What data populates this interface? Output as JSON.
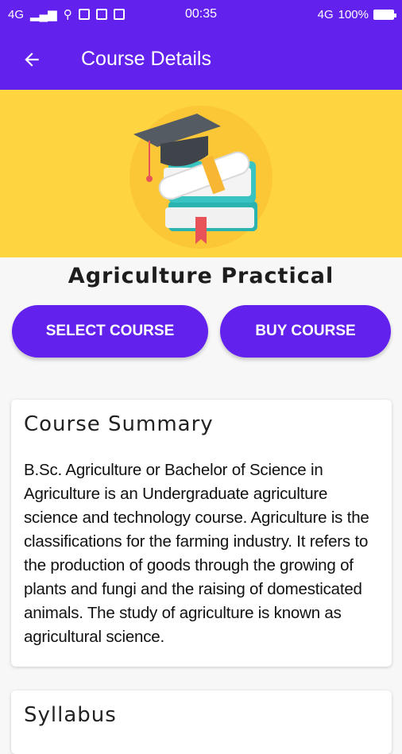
{
  "status_bar": {
    "network": "4G",
    "time": "00:35",
    "network_right": "4G",
    "battery": "100%"
  },
  "app_bar": {
    "title": "Course Details"
  },
  "course": {
    "name": "Agriculture Practical"
  },
  "actions": {
    "select_label": "SELECT COURSE",
    "buy_label": "BUY COURSE"
  },
  "summary": {
    "heading": "Course Summary",
    "body": "B.Sc. Agriculture or Bachelor of Science in Agriculture is an Undergraduate agriculture science and technology course. Agriculture is the classifications for the farming industry. It refers to the production of goods through the growing of plants and fungi and the raising of domesticated animals. The study of agriculture is known as agricultural science."
  },
  "syllabus": {
    "heading": "Syllabus"
  },
  "colors": {
    "primary": "#6321ee",
    "hero_bg": "#fed440"
  }
}
